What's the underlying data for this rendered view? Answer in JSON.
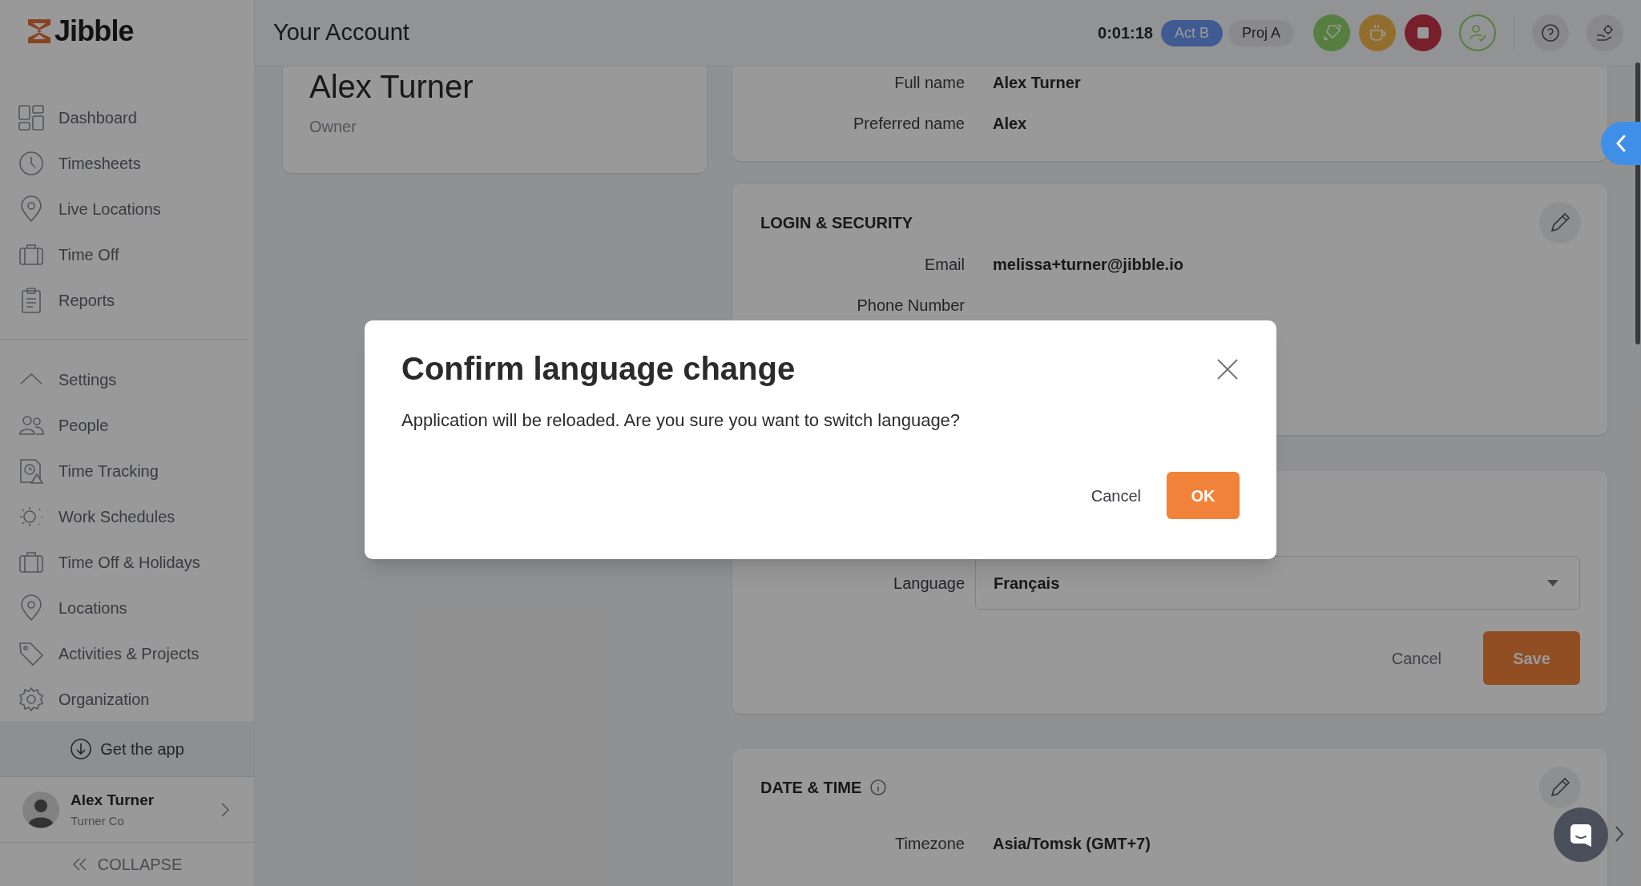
{
  "header": {
    "title": "Your Account",
    "timer": "0:01:18",
    "activity": "Act B",
    "project": "Proj A"
  },
  "sidebar": {
    "logo": "Jibble",
    "items": [
      {
        "label": "Dashboard"
      },
      {
        "label": "Timesheets"
      },
      {
        "label": "Live Locations"
      },
      {
        "label": "Time Off"
      },
      {
        "label": "Reports"
      }
    ],
    "settings": {
      "label": "Settings",
      "expanded": true,
      "children": [
        {
          "label": "People"
        },
        {
          "label": "Time Tracking"
        },
        {
          "label": "Work Schedules"
        },
        {
          "label": "Time Off & Holidays"
        },
        {
          "label": "Locations"
        },
        {
          "label": "Activities & Projects"
        },
        {
          "label": "Organization"
        }
      ]
    },
    "get_app": "Get the app",
    "user": {
      "name": "Alex Turner",
      "company": "Turner Co"
    },
    "collapse": "COLLAPSE"
  },
  "profile_card": {
    "name": "Alex Turner",
    "role": "Owner"
  },
  "personal_card": {
    "fields": [
      {
        "label": "Full name",
        "value": "Alex Turner"
      },
      {
        "label": "Preferred name",
        "value": "Alex"
      }
    ]
  },
  "login_security": {
    "title": "LOGIN & SECURITY",
    "fields": [
      {
        "label": "Email",
        "value": "melissa+turner@jibble.io"
      },
      {
        "label": "Phone Number"
      }
    ]
  },
  "language_card": {
    "label": "Language",
    "value": "Français",
    "cancel": "Cancel",
    "save": "Save"
  },
  "date_time": {
    "title": "DATE & TIME",
    "fields": [
      {
        "label": "Timezone",
        "value": "Asia/Tomsk (GMT+7)"
      }
    ]
  },
  "dialog": {
    "title": "Confirm language change",
    "message": "Application will be reloaded. Are you sure you want to switch language?",
    "cancel": "Cancel",
    "ok": "OK"
  }
}
